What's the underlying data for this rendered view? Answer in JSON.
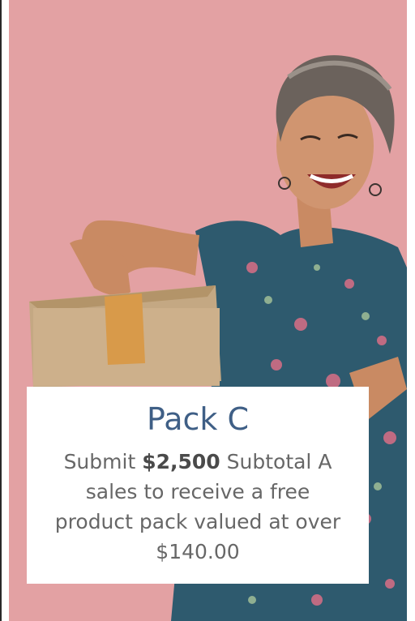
{
  "promo": {
    "title": "Pack C",
    "text_before": "Submit ",
    "amount": "$2,500",
    "text_after": " Subtotal A sales to receive a free product pack valued at over $140.00"
  },
  "colors": {
    "background": "#e3a1a3",
    "title": "#3f5f86",
    "body_text": "#676767",
    "card": "#ffffff"
  }
}
